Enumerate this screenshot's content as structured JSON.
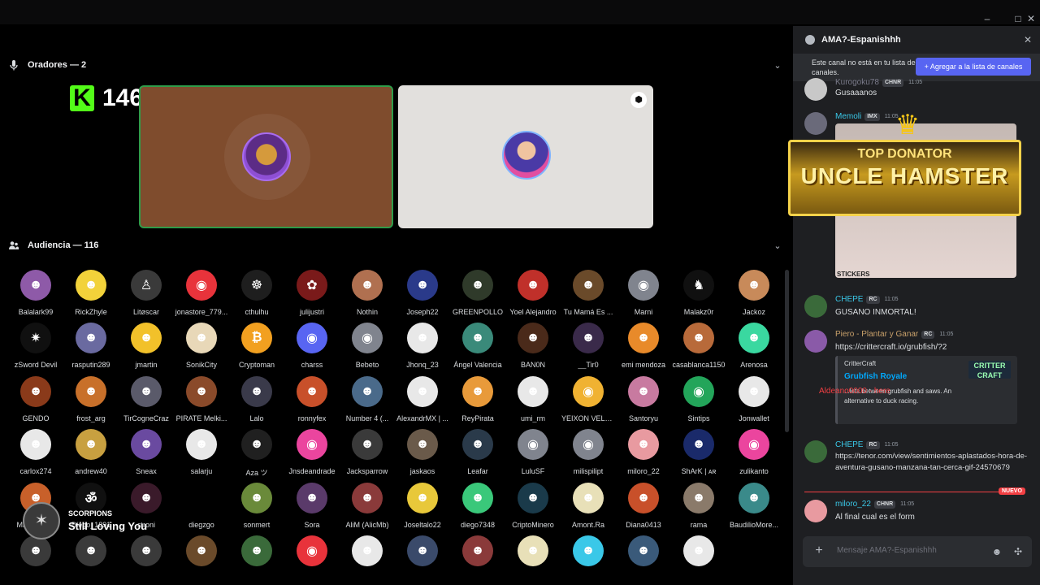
{
  "window": {
    "minimize": "–",
    "maximize": "□",
    "close": "✕"
  },
  "stage": {
    "speakers_label": "Oradores — 2",
    "audience_label": "Audiencia — 116",
    "kick_number": "146",
    "kick_letter": "K"
  },
  "audience": [
    {
      "name": "Balalark99",
      "color": "#8e5aa8",
      "glyph": "☻"
    },
    {
      "name": "RickZhyle",
      "color": "#f2d23a",
      "glyph": "☻"
    },
    {
      "name": "Litøscar",
      "color": "#3a3a3a",
      "glyph": "♙"
    },
    {
      "name": "jonastore_779...",
      "color": "#e8333b",
      "glyph": "◉"
    },
    {
      "name": "cthulhu",
      "color": "#1e1e1e",
      "glyph": "☸"
    },
    {
      "name": "julijustri",
      "color": "#7a1a1a",
      "glyph": "✿"
    },
    {
      "name": "Nothin",
      "color": "#b07050",
      "glyph": "☻"
    },
    {
      "name": "Joseph22",
      "color": "#2a3a8a",
      "glyph": "☻"
    },
    {
      "name": "GREENPOLLO",
      "color": "#2f3a2a",
      "glyph": "☻"
    },
    {
      "name": "Yoel Alejandro",
      "color": "#c0302a",
      "glyph": "☻"
    },
    {
      "name": "Tu Mamá Es ...",
      "color": "#6a4a2a",
      "glyph": "☻"
    },
    {
      "name": "Marni",
      "color": "#80848e",
      "glyph": "◉"
    },
    {
      "name": "Malakz0r",
      "color": "#101010",
      "glyph": "♞"
    },
    {
      "name": "Jackoz",
      "color": "#c88a5a",
      "glyph": "☻"
    },
    {
      "name": "zSword Devil",
      "color": "#101010",
      "glyph": "✷"
    },
    {
      "name": "rasputin289",
      "color": "#6a6aa0",
      "glyph": "☻"
    },
    {
      "name": "jmartin",
      "color": "#f2c12a",
      "glyph": "☻"
    },
    {
      "name": "SonikCity",
      "color": "#e8d8b8",
      "glyph": "☻"
    },
    {
      "name": "Cryptoman",
      "color": "#f2a020",
      "glyph": "₿"
    },
    {
      "name": "charss",
      "color": "#5865f2",
      "glyph": "◉"
    },
    {
      "name": "Bebeto",
      "color": "#80848e",
      "glyph": "◉"
    },
    {
      "name": "Jhonq_23",
      "color": "#e8e8e8",
      "glyph": "☻"
    },
    {
      "name": "Ángel Valencia",
      "color": "#3a8a7a",
      "glyph": "☻"
    },
    {
      "name": "BAN0N",
      "color": "#4a2a1a",
      "glyph": "☻"
    },
    {
      "name": "__Tir0",
      "color": "#3a2a4a",
      "glyph": "☻"
    },
    {
      "name": "emi mendoza",
      "color": "#e88a2a",
      "glyph": "☻"
    },
    {
      "name": "casablanca1150",
      "color": "#b86a3a",
      "glyph": "☻"
    },
    {
      "name": "Arenosa",
      "color": "#3ad8a0",
      "glyph": "☻"
    },
    {
      "name": "GENDO",
      "color": "#8a3a1a",
      "glyph": "☻"
    },
    {
      "name": "frost_arg",
      "color": "#c8702a",
      "glyph": "☻"
    },
    {
      "name": "TirCogneCraz",
      "color": "#5a5a6a",
      "glyph": "☻"
    },
    {
      "name": "PIRATE Melki...",
      "color": "#8a4a2a",
      "glyph": "☻"
    },
    {
      "name": "Lalo",
      "color": "#3a3a4a",
      "glyph": "☻"
    },
    {
      "name": "ronnyfex",
      "color": "#c8502a",
      "glyph": "☻"
    },
    {
      "name": "Number 4 (...",
      "color": "#4a6a8a",
      "glyph": "☻"
    },
    {
      "name": "AlexandrMX | ...",
      "color": "#e8e8e8",
      "glyph": "☻"
    },
    {
      "name": "ReyPirata",
      "color": "#e89a3a",
      "glyph": "☻"
    },
    {
      "name": "umi_rm",
      "color": "#e8e8e8",
      "glyph": "☻"
    },
    {
      "name": "YEIXON VELA...",
      "color": "#f0b232",
      "glyph": "◉"
    },
    {
      "name": "Santoryu",
      "color": "#c87aa0",
      "glyph": "☻"
    },
    {
      "name": "Sintips",
      "color": "#23a55a",
      "glyph": "◉"
    },
    {
      "name": "Jonwallet",
      "color": "#e8e8e8",
      "glyph": "☻"
    },
    {
      "name": "carlox274",
      "color": "#e8e8e8",
      "glyph": "☻"
    },
    {
      "name": "andrew40",
      "color": "#c8a040",
      "glyph": "☻"
    },
    {
      "name": "Sneax",
      "color": "#6a4aa0",
      "glyph": "☻"
    },
    {
      "name": "salarju",
      "color": "#e8e8e8",
      "glyph": "☻"
    },
    {
      "name": "Aza ツ",
      "color": "#202020",
      "glyph": "☻"
    },
    {
      "name": "Jnsdeandrade",
      "color": "#eb459e",
      "glyph": "◉"
    },
    {
      "name": "Jacksparrow",
      "color": "#3a3a3a",
      "glyph": "☻"
    },
    {
      "name": "jaskaos",
      "color": "#6a5a4a",
      "glyph": "☻"
    },
    {
      "name": "Leafar",
      "color": "#2a3a4a",
      "glyph": "☻"
    },
    {
      "name": "LuluSF",
      "color": "#80848e",
      "glyph": "◉"
    },
    {
      "name": "milispilipt",
      "color": "#80848e",
      "glyph": "◉"
    },
    {
      "name": "miloro_22",
      "color": "#e89aa0",
      "glyph": "☻"
    },
    {
      "name": "ShArK | ᴀʀ",
      "color": "#1a2a6a",
      "glyph": "☻"
    },
    {
      "name": "zulikanto",
      "color": "#eb459e",
      "glyph": "◉"
    },
    {
      "name": "Macondo88",
      "color": "#c8602a",
      "glyph": "☻"
    },
    {
      "name": "Diego_1891",
      "color": "#101010",
      "glyph": "ॐ"
    },
    {
      "name": "stroni",
      "color": "#3a1a2a",
      "glyph": "☻"
    },
    {
      "name": "diegzgo",
      "color": "#000000",
      "glyph": ""
    },
    {
      "name": "sonmert",
      "color": "#6a8a3a",
      "glyph": "☻"
    },
    {
      "name": "Sora",
      "color": "#5a3a6a",
      "glyph": "☻"
    },
    {
      "name": "AliM (AlicMb)",
      "color": "#8a3a3a",
      "glyph": "☻"
    },
    {
      "name": "Joseltalo22",
      "color": "#e8c83a",
      "glyph": "☻"
    },
    {
      "name": "diego7348",
      "color": "#3ac87a",
      "glyph": "☻"
    },
    {
      "name": "CriptoMinero",
      "color": "#1a3a4a",
      "glyph": "☻"
    },
    {
      "name": "Amont.Ra",
      "color": "#e8e0b8",
      "glyph": "☻"
    },
    {
      "name": "Diana0413",
      "color": "#c8502a",
      "glyph": "☻"
    },
    {
      "name": "rama",
      "color": "#8a7a6a",
      "glyph": "☻"
    },
    {
      "name": "BaudilioMore...",
      "color": "#3a8a8a",
      "glyph": "☻"
    },
    {
      "name": "",
      "color": "#3a3a3a",
      "glyph": "☻"
    },
    {
      "name": "",
      "color": "#3a3a3a",
      "glyph": "☻"
    },
    {
      "name": "",
      "color": "#3a3a3a",
      "glyph": "☻"
    },
    {
      "name": "",
      "color": "#6a4a2a",
      "glyph": "☻"
    },
    {
      "name": "",
      "color": "#3a6a3a",
      "glyph": "☻"
    },
    {
      "name": "",
      "color": "#e8333b",
      "glyph": "◉"
    },
    {
      "name": "",
      "color": "#e8e8e8",
      "glyph": "☻"
    },
    {
      "name": "",
      "color": "#3a4a6a",
      "glyph": "☻"
    },
    {
      "name": "",
      "color": "#8a3a3a",
      "glyph": "☻"
    },
    {
      "name": "",
      "color": "#e8e0b8",
      "glyph": "☻"
    },
    {
      "name": "",
      "color": "#3ac8e8",
      "glyph": "☻"
    },
    {
      "name": "",
      "color": "#3a5a7a",
      "glyph": "☻"
    },
    {
      "name": "",
      "color": "#e8e8e8",
      "glyph": "☻"
    }
  ],
  "now_playing": {
    "band": "SCORPIONS",
    "song": "Still Loving You"
  },
  "chat": {
    "title": "AMA?-Espanishhh",
    "notice": "Este canal no está en tu lista de canales.",
    "add_button": "Agregar a la lista de canales",
    "messages": [
      {
        "author": "Kurogoku78",
        "tag": "CHNR",
        "time": "11:05",
        "text": "Gusaaanos",
        "color": "#e8a0c8",
        "avatar": "#c8c8c8"
      },
      {
        "author": "Memoli",
        "tag": "IMX",
        "time": "11:05",
        "text": "",
        "color": "#3ac8e8",
        "avatar": "#6a6a7a"
      },
      {
        "author": "CHEPE",
        "tag": "RC",
        "time": "11:05",
        "text": "GUSANO INMORTAL!",
        "color": "#3ac8e8",
        "avatar": "#3a6a3a"
      },
      {
        "author": "Piero - Plantar y Ganar",
        "tag": "RC",
        "time": "11:05",
        "text": "https://crittercraft.io/grubfish/?2",
        "color": "#c8a06a",
        "avatar": "#8a5aa8"
      },
      {
        "author": "CHEPE",
        "tag": "RC",
        "time": "11:05",
        "text": "https://tenor.com/view/sentimientos-aplastados-hora-de-aventura-gusano-manzana-tan-cerca-gif-24570679",
        "color": "#3ac8e8",
        "avatar": "#3a6a3a"
      },
      {
        "author": "miloro_22",
        "tag": "CHNR",
        "time": "11:05",
        "text": "Al final cual es el form",
        "color": "#3ac8e8",
        "avatar": "#e89aa0"
      }
    ],
    "sticker_label": "STICKERS",
    "embed": {
      "provider": "CritterCraft",
      "title": "Grubfish Royale",
      "desc": "...lets between grubfish and saws. An alternative to duck racing.",
      "thumb": "CRITTER CRAFT"
    },
    "new_badge": "NUEVO",
    "input_placeholder": "Mensaje AMA?-Espanishhh"
  },
  "donator": {
    "line1": "TOP DONATOR",
    "line2": "UNCLE HAMSTER",
    "alert": "Aldeano0000 - here"
  }
}
